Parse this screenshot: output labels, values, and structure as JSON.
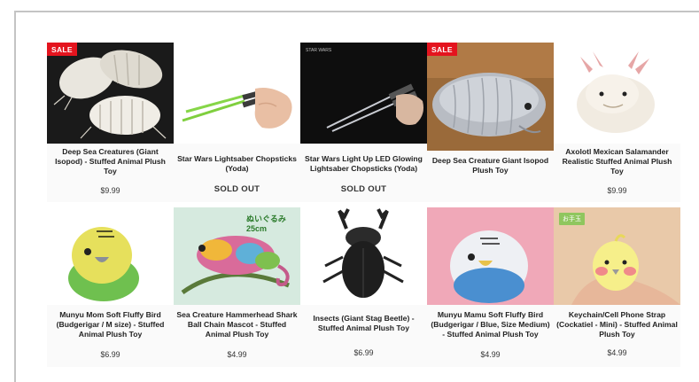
{
  "products": [
    {
      "title": "Deep Sea Creatures (Giant Isopod) - Stuffed Animal Plush Toy",
      "price": "$9.99",
      "badge": "SALE",
      "image": "giant-isopod-plush-group-image"
    },
    {
      "title": "Star Wars Lightsaber Chopsticks (Yoda)",
      "status": "SOLD OUT",
      "image": "lightsaber-chopsticks-image"
    },
    {
      "title": "Star Wars Light Up LED Glowing Lightsaber Chopsticks (Yoda)",
      "status": "SOLD OUT",
      "image": "led-lightsaber-chopsticks-image"
    },
    {
      "title": "Deep Sea Creature Giant Isopod Plush Toy",
      "badge": "SALE",
      "image": "giant-isopod-plush-image"
    },
    {
      "title": "Axolotl Mexican Salamander Realistic Stuffed Animal Plush Toy",
      "price": "$9.99",
      "image": "axolotl-plush-image"
    },
    {
      "title": "Munyu Mom Soft Fluffy Bird (Budgerigar / M size) - Stuffed Animal Plush Toy",
      "price": "$6.99",
      "image": "budgerigar-plush-green-image"
    },
    {
      "title": "Sea Creature Hammerhead Shark Ball Chain Mascot - Stuffed Animal Plush Toy",
      "price": "$4.99",
      "image": "chameleon-plush-image",
      "image_text": "ぬいぐるみ 25cm"
    },
    {
      "title": "Insects (Giant Stag Beetle) - Stuffed Animal Plush Toy",
      "price": "$6.99",
      "image": "stag-beetle-plush-image"
    },
    {
      "title": "Munyu Mamu Soft Fluffy Bird (Budgerigar / Blue, Size Medium) - Stuffed Animal Plush Toy",
      "price": "$4.99",
      "image": "budgerigar-plush-blue-image"
    },
    {
      "title": "Keychain/Cell Phone Strap (Cockatiel - Mini) - Stuffed Animal Plush Toy",
      "price": "$4.99",
      "image": "cockatiel-plush-image",
      "image_text": "お手玉"
    }
  ]
}
